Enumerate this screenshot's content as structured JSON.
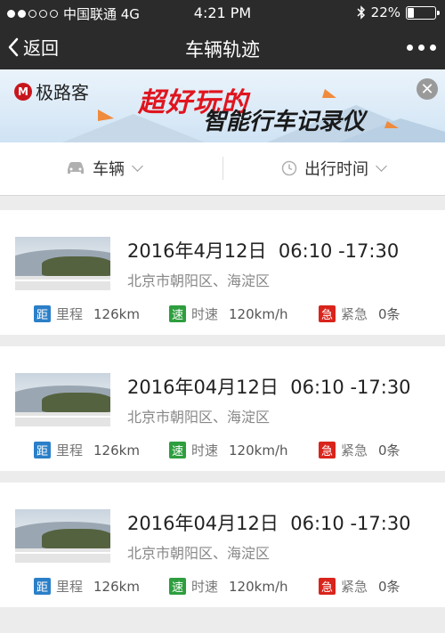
{
  "status_bar": {
    "carrier": "中国联通 4G",
    "time": "4:21 PM",
    "battery_text": "22%",
    "battery_level": 0.22,
    "signal_bars": 2
  },
  "nav": {
    "back_label": "返回",
    "title": "车辆轨迹"
  },
  "banner": {
    "brand": "极路客",
    "slogan_line1": "超好玩的",
    "slogan_line2": "智能行车记录仪"
  },
  "filters": {
    "vehicle_label": "车辆",
    "time_label": "出行时间"
  },
  "colors": {
    "badge_distance": "#2b7fc8",
    "badge_speed": "#2e9e3e",
    "badge_urgent": "#d9241c"
  },
  "trips": [
    {
      "date": "2016年4月12日",
      "time_range": "06:10 -17:30",
      "location": "北京市朝阳区、海淀区",
      "distance_badge": "距",
      "distance_label": "里程",
      "distance_value": "126km",
      "speed_badge": "速",
      "speed_label": "时速",
      "speed_value": "120km/h",
      "urgent_badge": "急",
      "urgent_label": "紧急",
      "urgent_value": "0条"
    },
    {
      "date": "2016年04月12日",
      "time_range": "06:10 -17:30",
      "location": "北京市朝阳区、海淀区",
      "distance_badge": "距",
      "distance_label": "里程",
      "distance_value": "126km",
      "speed_badge": "速",
      "speed_label": "时速",
      "speed_value": "120km/h",
      "urgent_badge": "急",
      "urgent_label": "紧急",
      "urgent_value": "0条"
    },
    {
      "date": "2016年04月12日",
      "time_range": "06:10 -17:30",
      "location": "北京市朝阳区、海淀区",
      "distance_badge": "距",
      "distance_label": "里程",
      "distance_value": "126km",
      "speed_badge": "速",
      "speed_label": "时速",
      "speed_value": "120km/h",
      "urgent_badge": "急",
      "urgent_label": "紧急",
      "urgent_value": "0条"
    }
  ]
}
